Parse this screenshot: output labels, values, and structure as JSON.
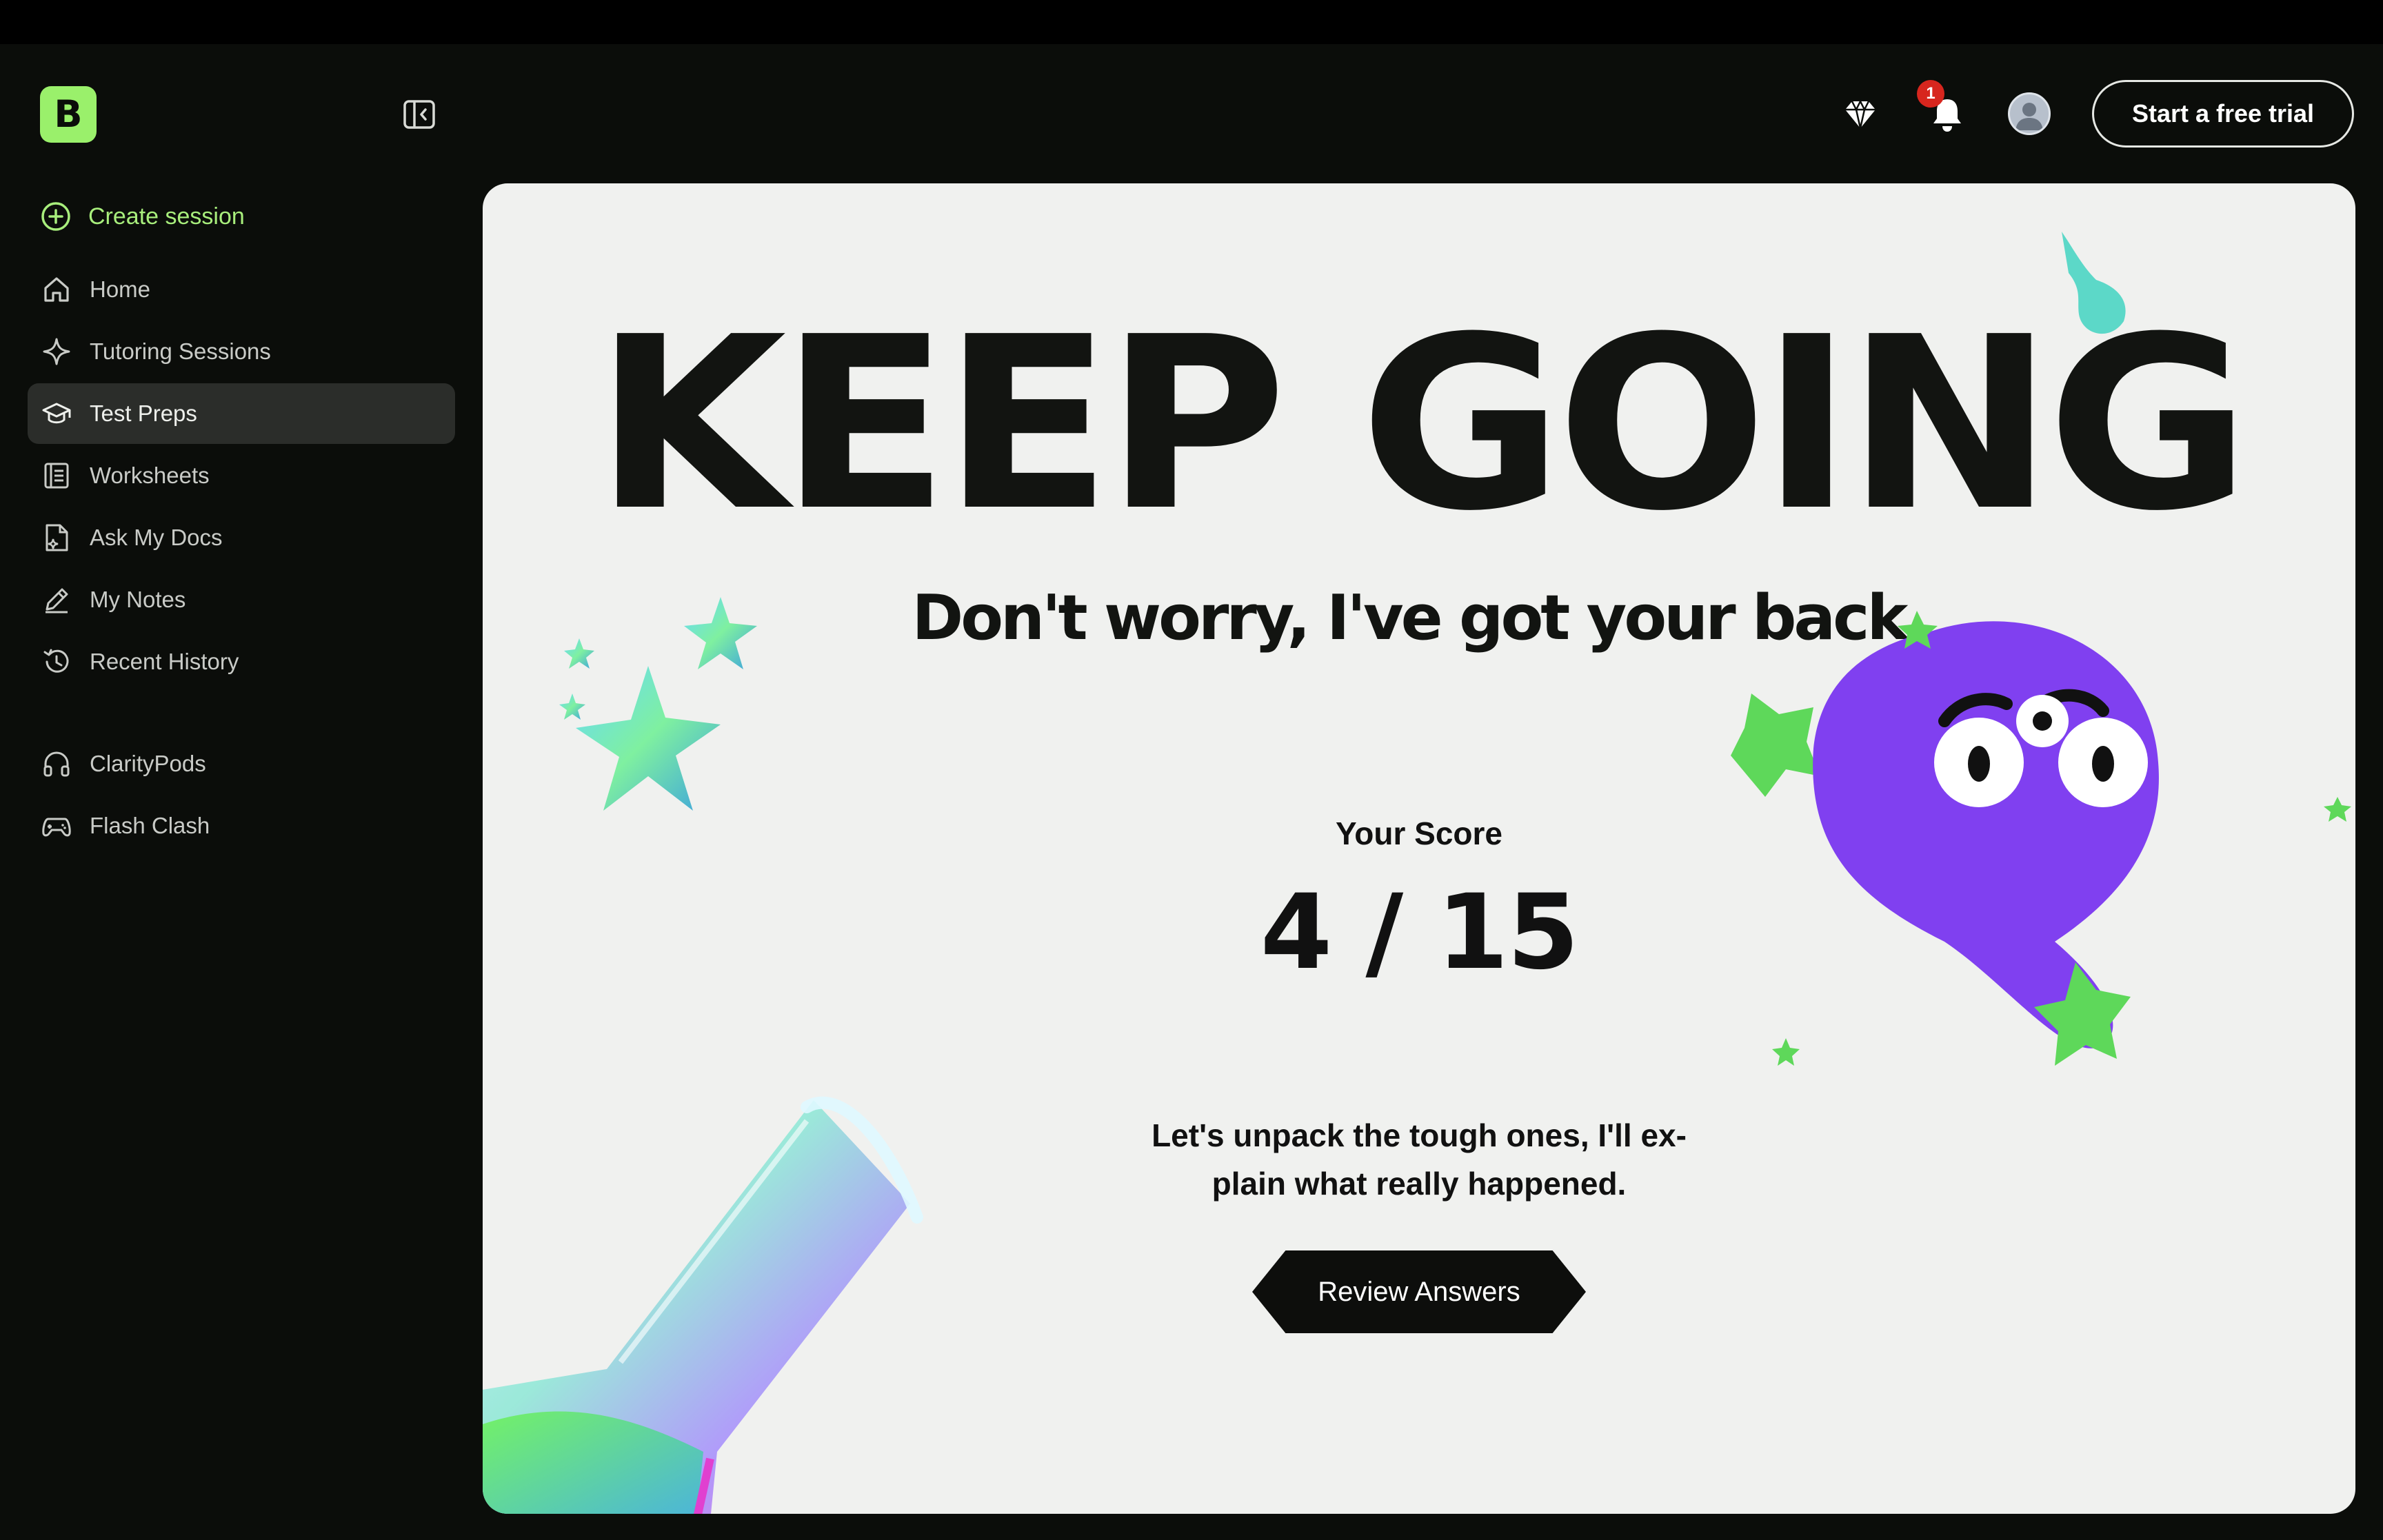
{
  "sidebar": {
    "logo_letter": "B",
    "create_session": "Create session",
    "items": [
      {
        "label": "Home",
        "icon": "home-icon"
      },
      {
        "label": "Tutoring Sessions",
        "icon": "sparkle-icon"
      },
      {
        "label": "Test Preps",
        "icon": "graduation-cap-icon",
        "active": true
      },
      {
        "label": "Worksheets",
        "icon": "worksheet-icon"
      },
      {
        "label": "Ask My Docs",
        "icon": "document-icon"
      },
      {
        "label": "My Notes",
        "icon": "pencil-icon"
      },
      {
        "label": "Recent History",
        "icon": "history-icon"
      }
    ],
    "extra_items": [
      {
        "label": "ClarityPods",
        "icon": "headphones-icon"
      },
      {
        "label": "Flash Clash",
        "icon": "gamepad-icon"
      }
    ]
  },
  "header": {
    "notification_count": "1",
    "trial_button": "Start a free trial"
  },
  "result": {
    "headline": "KEEP GOING",
    "subheadline": "Don't worry, I've got your back.",
    "score_label": "Your Score",
    "score_value": "4 / 15",
    "message_line1": "Let's unpack the tough ones, I'll ex-",
    "message_line2": "plain what really happened.",
    "review_button": "Review Answers"
  },
  "colors": {
    "accent_green": "#9af06b",
    "mascot_purple": "#8040f0",
    "sparkle_green": "#5ed85a",
    "card_background": "#f0f1ef",
    "app_background": "#0b0d0a"
  }
}
